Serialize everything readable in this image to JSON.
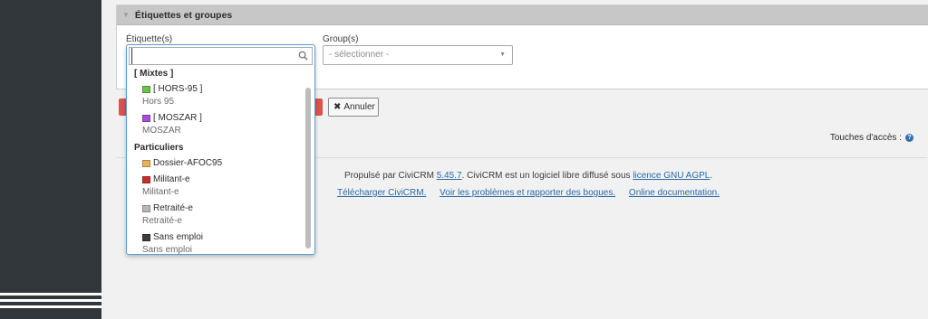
{
  "panel": {
    "title": "Étiquettes et groupes"
  },
  "form": {
    "tags_label": "Étiquette(s)",
    "groups_label": "Group(s)",
    "groups_placeholder": "- sélectionner -"
  },
  "dropdown": {
    "search_value": "",
    "groups": [
      {
        "title": "[ Mixtes ]",
        "options": [
          {
            "label": "[ HORS-95 ]",
            "description": "Hors 95",
            "color": "#6fbf4e"
          },
          {
            "label": "[ MOSZAR ]",
            "description": "MOSZAR",
            "color": "#a64fd6"
          }
        ]
      },
      {
        "title": "Particuliers",
        "options": [
          {
            "label": "Dossier-AFOC95",
            "description": "",
            "color": "#e8b15c"
          },
          {
            "label": "Militant-e",
            "description": "Militant-e",
            "color": "#c9302c"
          },
          {
            "label": "Retraité-e",
            "description": "Retraité-e",
            "color": "#b8b8b8"
          },
          {
            "label": "Sans emploi",
            "description": "Sans emploi",
            "color": "#3c3c3c"
          }
        ]
      }
    ]
  },
  "buttons": {
    "cancel_label": "Annuler"
  },
  "access_keys": {
    "label": "Touches d'accès :"
  },
  "footer": {
    "powered_prefix": "Propulsé par CiviCRM",
    "version": "5.45.7",
    "powered_middle": ". CiviCRM est un logiciel libre diffusé sous",
    "license": "licence GNU AGPL",
    "powered_suffix": ".",
    "download": "Télécharger CiviCRM.",
    "issues": "Voir les problèmes et rapporter des bogues.",
    "docs": "Online documentation."
  }
}
